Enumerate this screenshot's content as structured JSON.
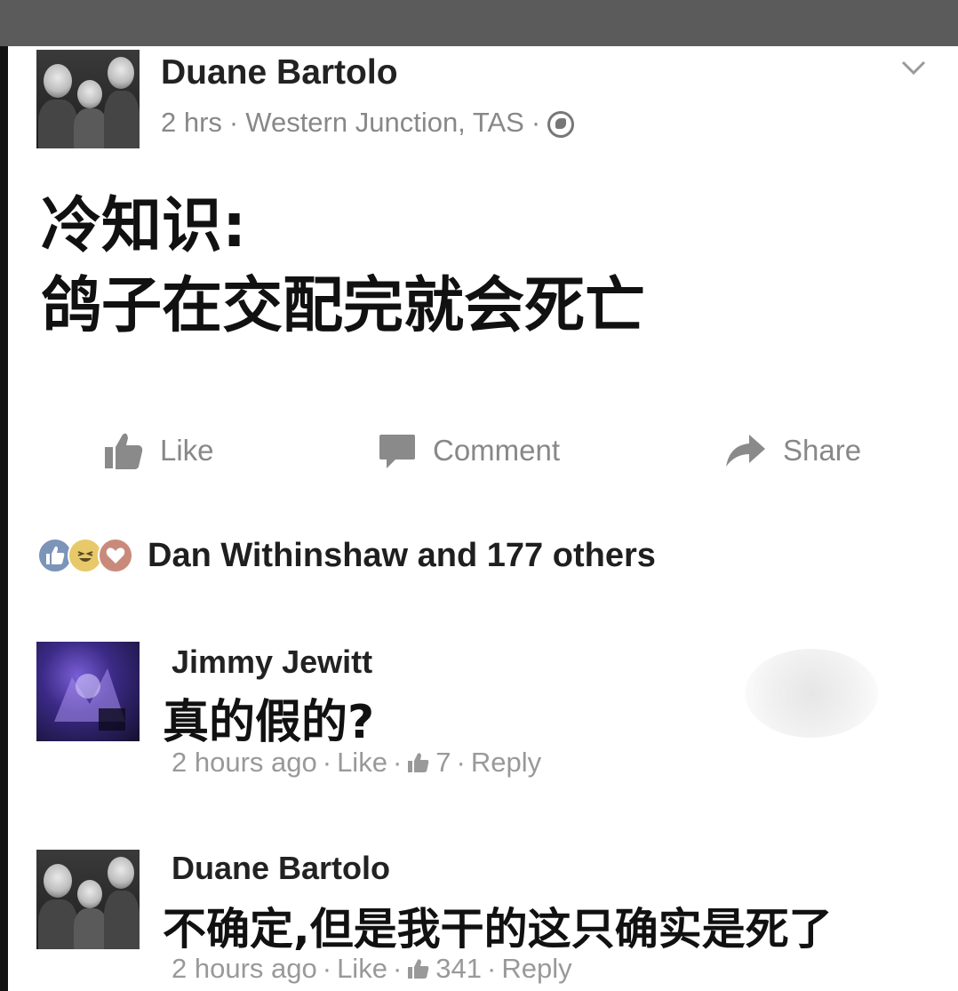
{
  "post": {
    "author": "Duane Bartolo",
    "time": "2 hrs",
    "sep1": "·",
    "location": "Western Junction, TAS",
    "sep2": "·",
    "text_line1": "冷知识:",
    "text_line2": "鸽子在交配完就会死亡"
  },
  "actions": {
    "like": "Like",
    "comment": "Comment",
    "share": "Share"
  },
  "reactions": {
    "summary": "Dan Withinshaw and 177 others"
  },
  "comments": [
    {
      "author": "Jimmy Jewitt",
      "text": "真的假的?",
      "time": "2 hours ago",
      "sep1": "·",
      "like": "Like",
      "sep2": "·",
      "likes": "7",
      "sep3": "·",
      "reply": "Reply"
    },
    {
      "author": "Duane Bartolo",
      "text": "不确定,但是我干的这只确实是死了",
      "time": "2 hours ago",
      "sep1": "·",
      "like": "Like",
      "sep2": "·",
      "likes": "341",
      "sep3": "·",
      "reply": "Reply"
    }
  ],
  "icons": {
    "menu": "chevron-down-icon",
    "privacy": "globe-icon",
    "like": "thumbs-up-icon",
    "comment": "comment-bubble-icon",
    "share": "share-arrow-icon"
  },
  "colors": {
    "top_bar": "#5b5b5b",
    "meta_text": "#888888",
    "body_text": "#111111"
  }
}
